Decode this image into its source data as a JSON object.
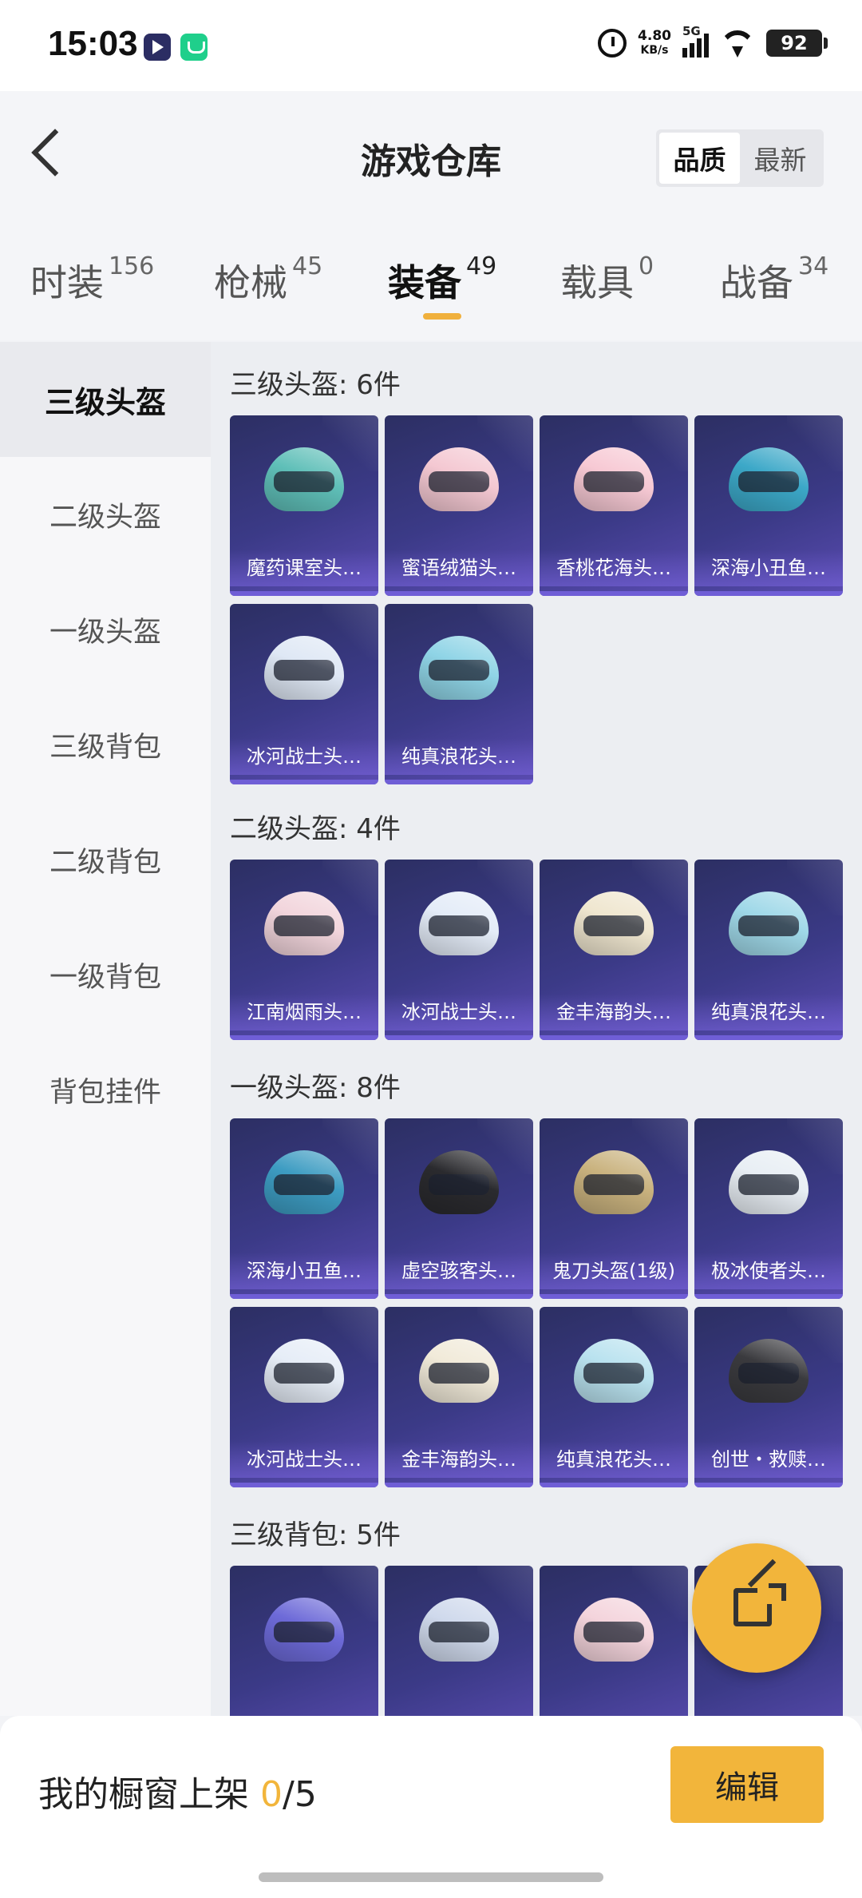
{
  "status": {
    "time": "15:03",
    "speed_value": "4.80",
    "speed_unit": "KB/s",
    "network": "5G",
    "battery": "92"
  },
  "header": {
    "title": "游戏仓库",
    "sort": [
      "品质",
      "最新"
    ]
  },
  "tabs": [
    {
      "label": "时装",
      "count": "156"
    },
    {
      "label": "枪械",
      "count": "45"
    },
    {
      "label": "装备",
      "count": "49"
    },
    {
      "label": "载具",
      "count": "0"
    },
    {
      "label": "战备",
      "count": "34"
    }
  ],
  "sidebar": [
    "三级头盔",
    "二级头盔",
    "一级头盔",
    "三级背包",
    "二级背包",
    "一级背包",
    "背包挂件"
  ],
  "sections": [
    {
      "title": "三级头盔: 6件",
      "items": [
        "魔药课室头…",
        "蜜语绒猫头…",
        "香桃花海头…",
        "深海小丑鱼…",
        "冰河战士头…",
        "纯真浪花头…"
      ]
    },
    {
      "title": "二级头盔: 4件",
      "items": [
        "江南烟雨头…",
        "冰河战士头…",
        "金丰海韵头…",
        "纯真浪花头…"
      ]
    },
    {
      "title": "一级头盔: 8件",
      "items": [
        "深海小丑鱼…",
        "虚空骇客头…",
        "鬼刀头盔(1级)",
        "极冰使者头…",
        "冰河战士头…",
        "金丰海韵头…",
        "纯真浪花头…",
        "创世・救赎…"
      ]
    },
    {
      "title": "三级背包: 5件",
      "items": [
        "",
        "",
        "",
        ""
      ]
    }
  ],
  "item_colors": [
    [
      "#5fbfb8",
      "#f4c8d2",
      "#f7c9d4",
      "#3ca8c8",
      "#dfe8f5",
      "#8fd4e6"
    ],
    [
      "#f2d5dc",
      "#e4ecf8",
      "#efe6cf",
      "#9fd8e8"
    ],
    [
      "#3d9cc2",
      "#2a2a2e",
      "#c9b27e",
      "#e8eef4",
      "#e6edf7",
      "#f1ead9",
      "#b9e2ef",
      "#3a3a3e"
    ],
    [
      "#6d6ad8",
      "#cfd9ec",
      "#f4d4dc",
      "#3b68c9"
    ]
  ],
  "bottom": {
    "showcase_label": "我的橱窗上架",
    "count": "0",
    "total": "/5",
    "edit": "编辑"
  }
}
